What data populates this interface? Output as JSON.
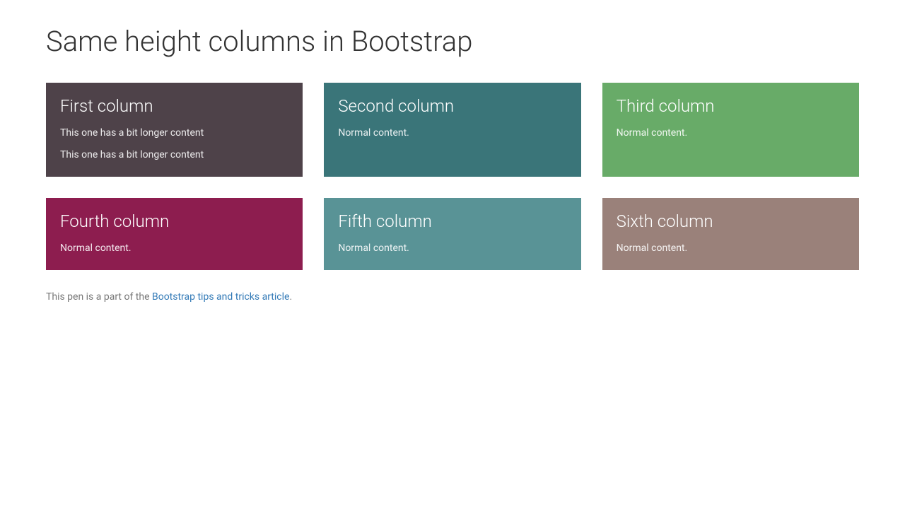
{
  "page": {
    "title": "Same height columns in Bootstrap"
  },
  "rows": [
    {
      "cols": [
        {
          "title": "First column",
          "paragraphs": [
            "This one has a bit longer content",
            "This one has a bit longer content"
          ],
          "bg": "#4E4249"
        },
        {
          "title": "Second column",
          "paragraphs": [
            "Normal content."
          ],
          "bg": "#3A7579"
        },
        {
          "title": "Third column",
          "paragraphs": [
            "Normal content."
          ],
          "bg": "#68AB68"
        }
      ]
    },
    {
      "cols": [
        {
          "title": "Fourth column",
          "paragraphs": [
            "Normal content."
          ],
          "bg": "#8D1D4F"
        },
        {
          "title": "Fifth column",
          "paragraphs": [
            "Normal content."
          ],
          "bg": "#599396"
        },
        {
          "title": "Sixth column",
          "paragraphs": [
            "Normal content."
          ],
          "bg": "#9A817A"
        }
      ]
    }
  ],
  "footer": {
    "prefix": "This pen is a part of the ",
    "link_text": "Bootstrap tips and tricks article",
    "suffix": "."
  }
}
